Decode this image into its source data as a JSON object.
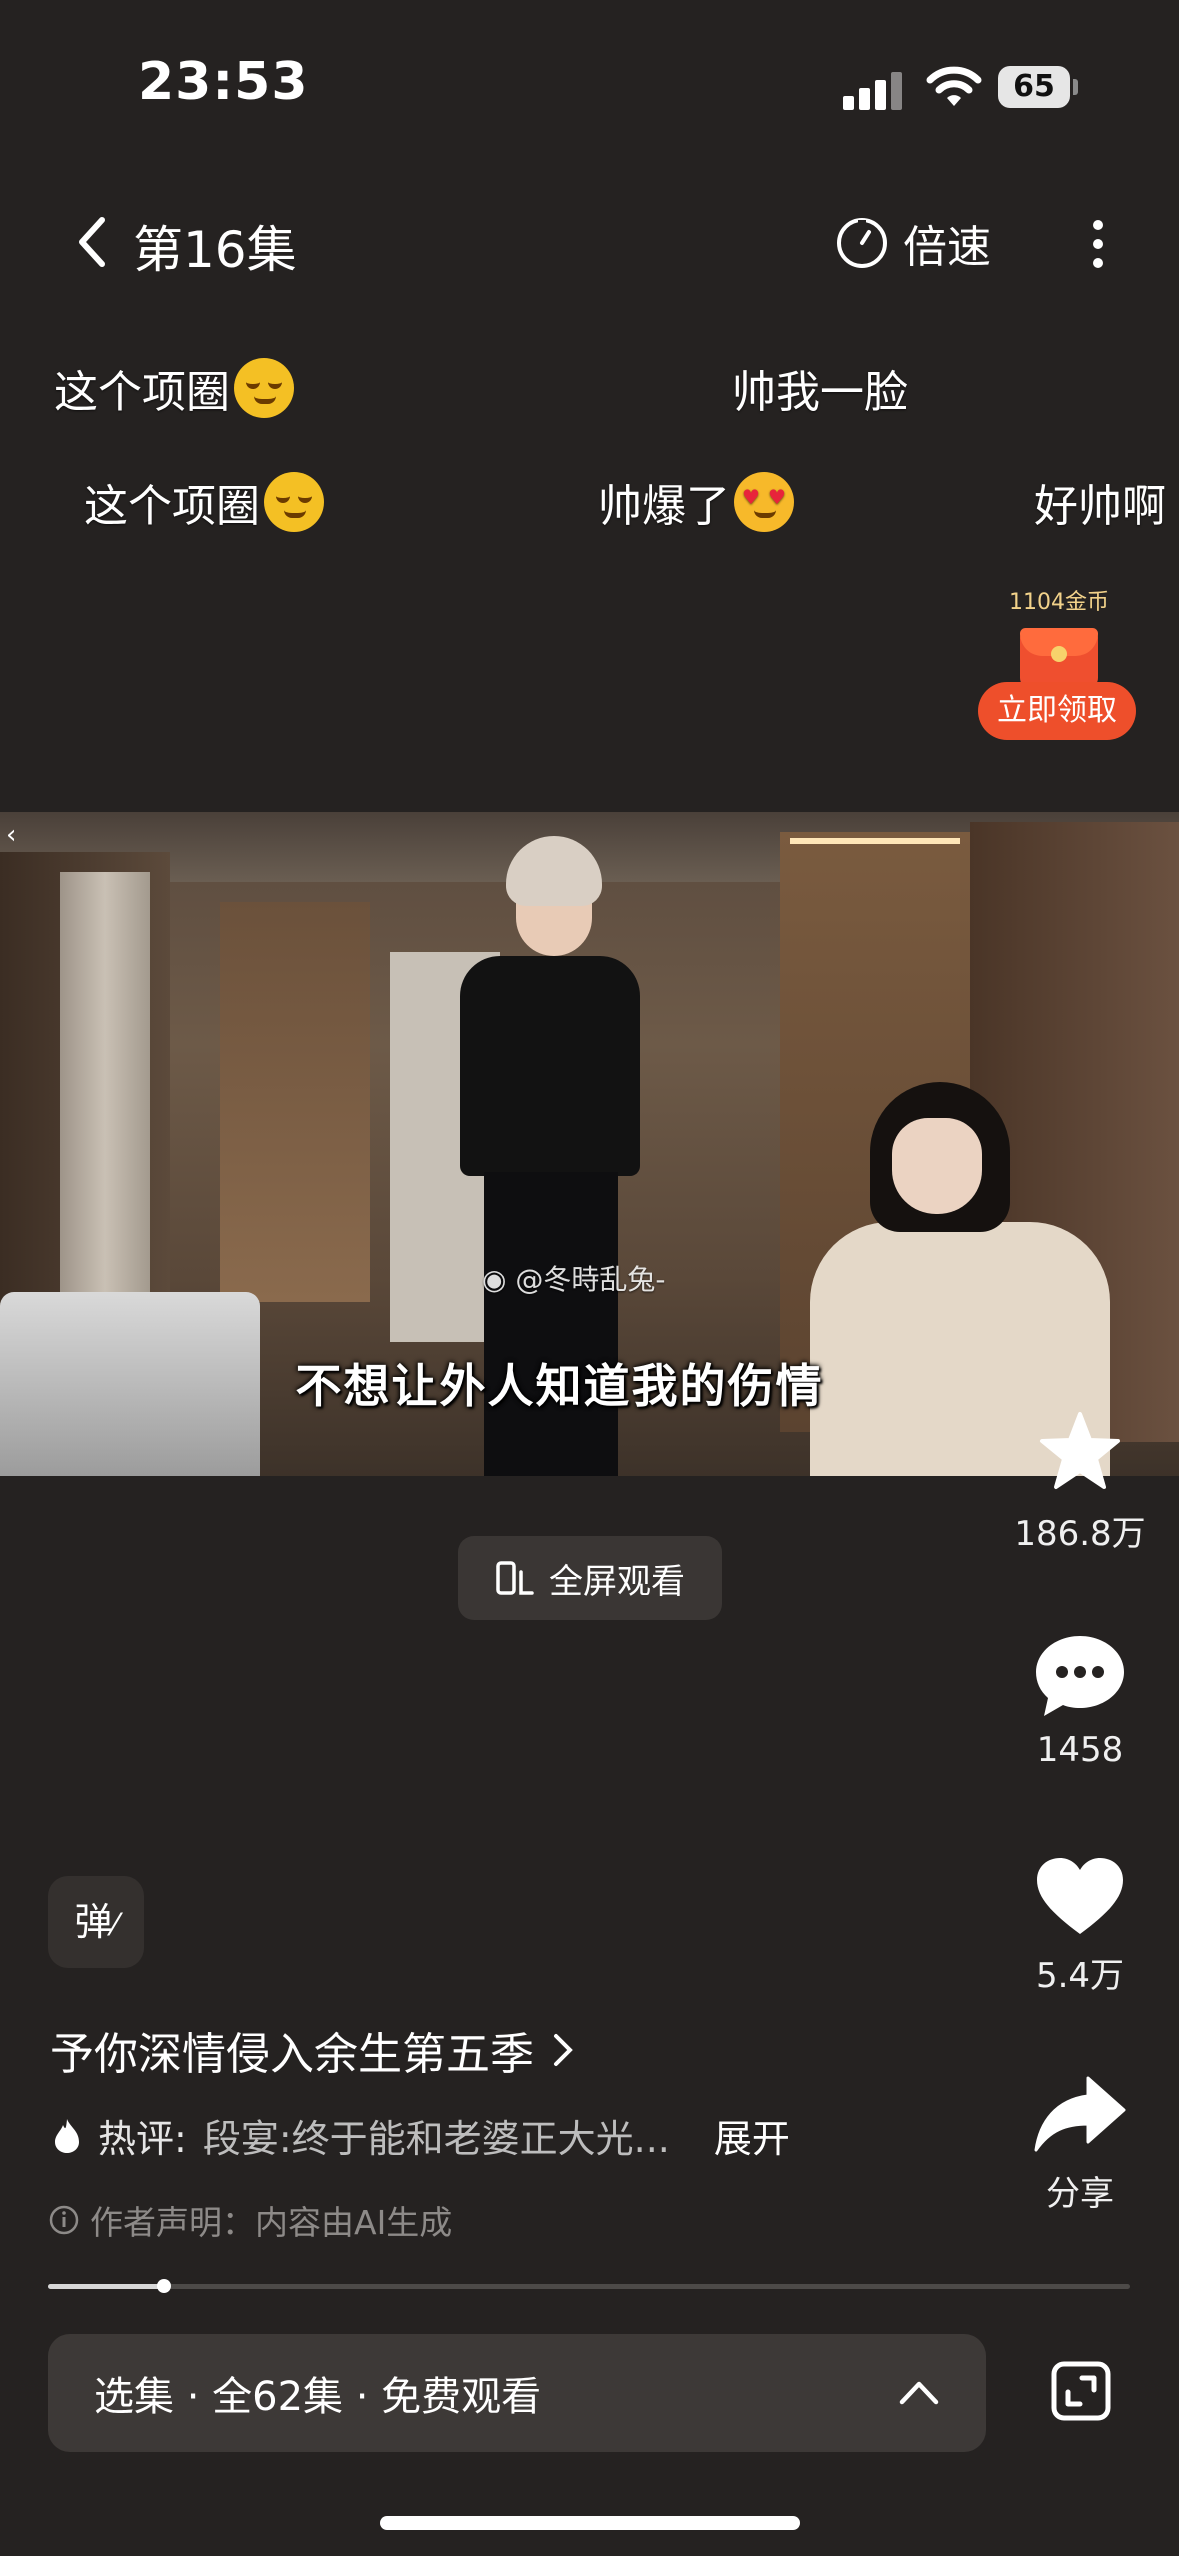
{
  "status_bar": {
    "time": "23:53",
    "battery": "65"
  },
  "nav": {
    "episode_title": "第16集",
    "speed_label": "倍速"
  },
  "danmaku": [
    {
      "text": "这个项圈",
      "emoji": "sly-smile"
    },
    {
      "text": "帅我一脸"
    },
    {
      "text": "这个项圈",
      "emoji": "sly-smile"
    },
    {
      "text": "帅爆了",
      "emoji": "heart-eyes"
    },
    {
      "text": "好帅啊"
    }
  ],
  "reward": {
    "coins": "1104金币",
    "claim_label": "立即领取"
  },
  "video": {
    "watermark": "@冬時乱兔-",
    "subtitle": "不想让外人知道我的伤情"
  },
  "fullscreen_label": "全屏观看",
  "actions": {
    "favorite_count": "186.8万",
    "comment_count": "1458",
    "like_count": "5.4万",
    "share_label": "分享"
  },
  "danmaku_toggle": "弹",
  "show": {
    "title": "予你深情侵入余生第五季",
    "hot_label": "热评:",
    "hot_comment": "段宴:终于能和老婆正大光...",
    "expand_label": "展开",
    "ai_note": "作者声明：内容由AI生成"
  },
  "playback": {
    "progress": 0.107
  },
  "episode_bar": {
    "label": "选集 · 全62集 · 免费观看"
  },
  "colors": {
    "background": "#252221",
    "accent_red": "#ee4f2b"
  }
}
